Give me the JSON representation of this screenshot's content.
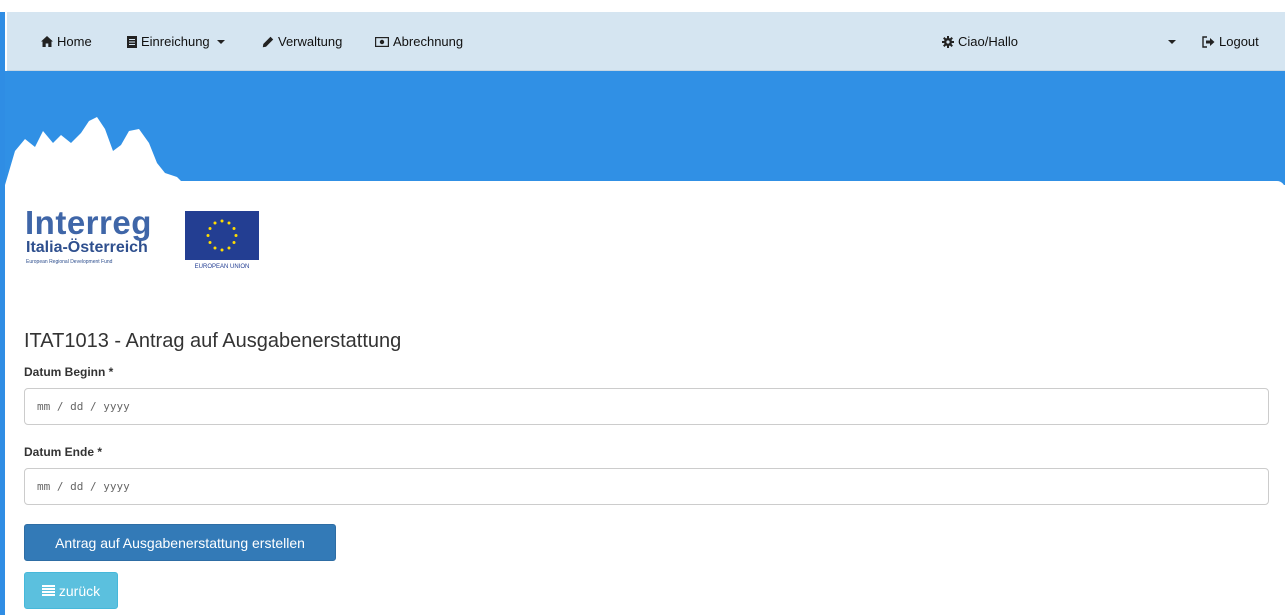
{
  "navbar": {
    "home": "Home",
    "einreichung": "Einreichung",
    "verwaltung": "Verwaltung",
    "abrechnung": "Abrechnung",
    "user": "Ciao/Hallo",
    "logout": "Logout"
  },
  "logo": {
    "wordmark": "Interreg",
    "region": "Italia-Österreich",
    "fund": "European Regional Development Fund",
    "eu_label": "EUROPEAN UNION"
  },
  "page": {
    "title": "ITAT1013 - Antrag auf Ausgabenerstattung"
  },
  "form": {
    "start_label": "Datum Beginn *",
    "start_placeholder": "mm / dd / yyyy",
    "end_label": "Datum Ende *",
    "end_placeholder": "mm / dd / yyyy",
    "submit_label": "Antrag auf Ausgabenerstattung erstellen",
    "back_label": "zurück"
  },
  "colors": {
    "navbar_bg": "#d5e5f1",
    "banner_blue": "#3090e5",
    "primary_button": "#337ab7",
    "info_button": "#5bc0de",
    "logo_blue": "#3f66a8",
    "eu_blue": "#233e92",
    "eu_star": "#ffdd00"
  },
  "icons": {
    "home": "home-icon",
    "einreichung": "document-icon",
    "verwaltung": "pencil-icon",
    "abrechnung": "banknote-icon",
    "user": "gear-icon",
    "logout": "logout-icon",
    "back": "list-icon"
  }
}
